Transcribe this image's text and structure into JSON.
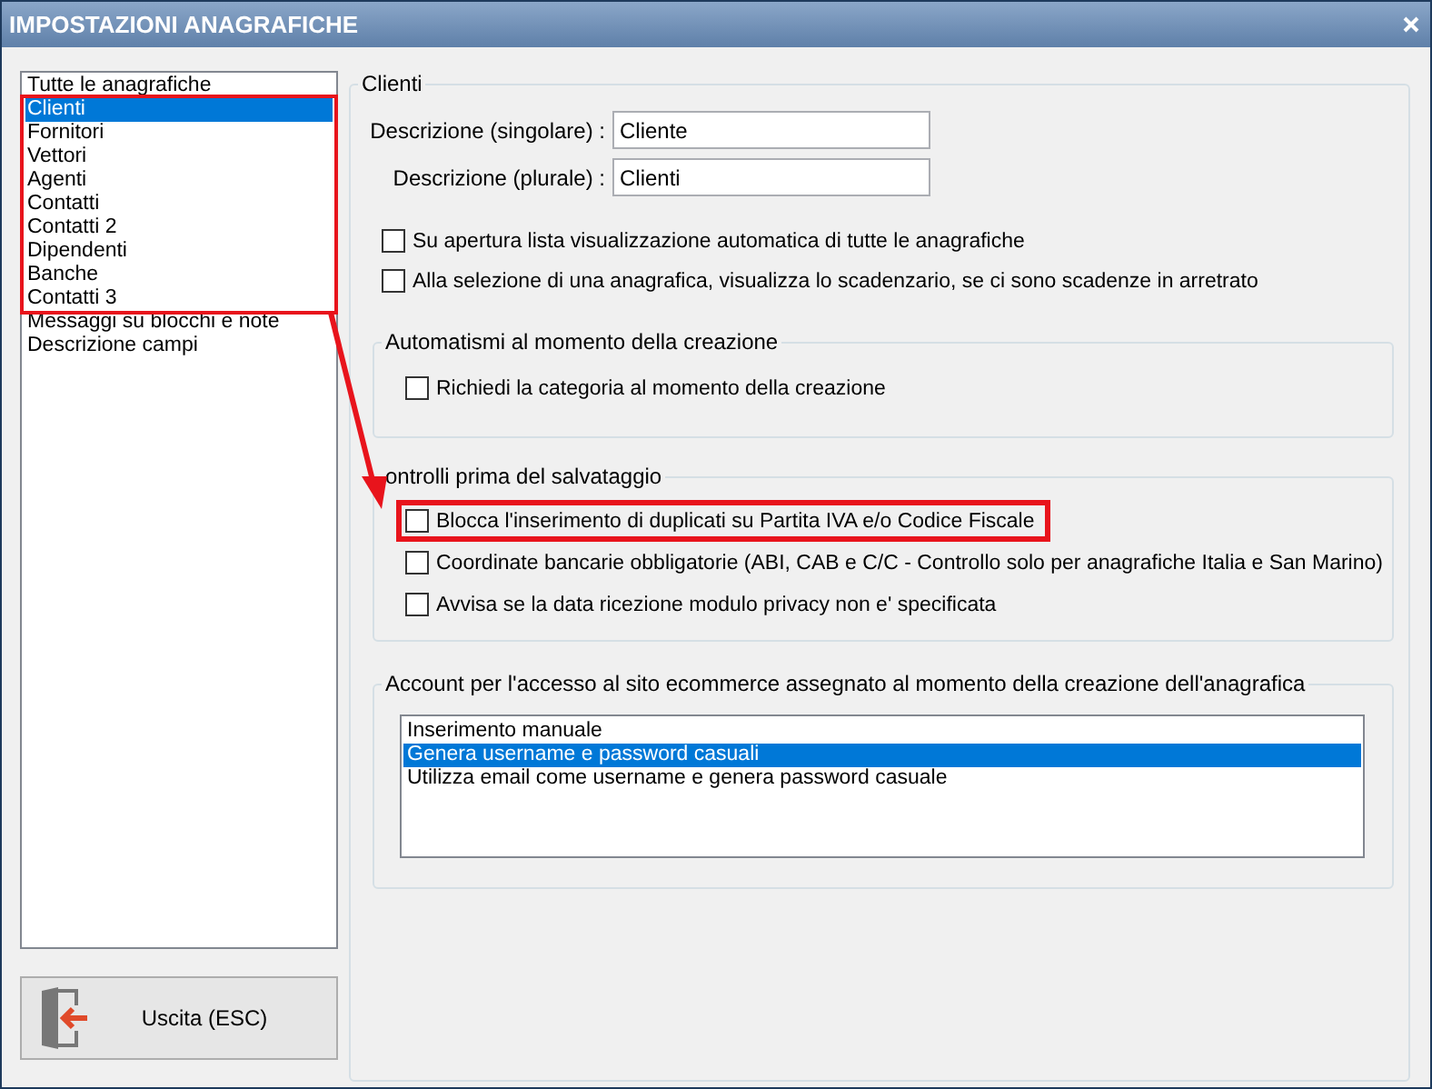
{
  "window": {
    "title": "IMPOSTAZIONI ANAGRAFICHE"
  },
  "sidebar": {
    "items": [
      {
        "label": "Tutte le anagrafiche",
        "selected": false
      },
      {
        "label": "Clienti",
        "selected": true
      },
      {
        "label": "Fornitori",
        "selected": false
      },
      {
        "label": "Vettori",
        "selected": false
      },
      {
        "label": "Agenti",
        "selected": false
      },
      {
        "label": "Contatti",
        "selected": false
      },
      {
        "label": "Contatti 2",
        "selected": false
      },
      {
        "label": "Dipendenti",
        "selected": false
      },
      {
        "label": "Banche",
        "selected": false
      },
      {
        "label": "Contatti 3",
        "selected": false
      },
      {
        "label": "Messaggi su blocchi e note",
        "selected": false
      },
      {
        "label": "Descrizione campi",
        "selected": false
      }
    ]
  },
  "exit_button": {
    "label": "Uscita (ESC)"
  },
  "clienti": {
    "title": "Clienti",
    "fields": [
      {
        "label": "Descrizione (singolare) :",
        "value": "Cliente"
      },
      {
        "label": "Descrizione (plurale) :",
        "value": "Clienti"
      }
    ],
    "options": [
      {
        "label": "Su apertura lista visualizzazione automatica di tutte le anagrafiche",
        "checked": false
      },
      {
        "label": "Alla selezione di una anagrafica, visualizza lo scadenzario, se ci sono scadenze in arretrato",
        "checked": false
      }
    ]
  },
  "automatismi": {
    "title": "Automatismi al momento della creazione",
    "options": [
      {
        "label": "Richiedi la categoria al momento della creazione",
        "checked": false
      }
    ]
  },
  "controlli": {
    "title": "ontrolli prima del salvataggio",
    "options": [
      {
        "label": "Blocca l'inserimento di duplicati su Partita IVA e/o Codice Fiscale",
        "checked": false,
        "highlighted": true
      },
      {
        "label": "Coordinate bancarie obbligatorie (ABI, CAB e C/C - Controllo solo per anagrafiche Italia e San Marino)",
        "checked": false
      },
      {
        "label": "Avvisa se la data ricezione modulo privacy non e' specificata",
        "checked": false
      }
    ]
  },
  "account": {
    "title": "Account per l'accesso al sito ecommerce assegnato al momento della creazione dell'anagrafica",
    "items": [
      {
        "label": "Inserimento manuale",
        "selected": false
      },
      {
        "label": "Genera username e password casuali",
        "selected": true
      },
      {
        "label": "Utilizza email come username e genera password casuale",
        "selected": false
      }
    ]
  }
}
